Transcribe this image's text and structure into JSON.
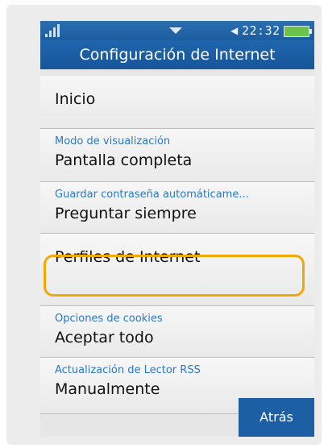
{
  "status_bar": {
    "time": "22:32",
    "icons": [
      "signal-icon",
      "dropdown-arrow-icon",
      "speaker-icon",
      "battery-icon"
    ]
  },
  "header": {
    "title": "Configuración de Internet"
  },
  "settings": [
    {
      "id": "inicio",
      "subtitle": "",
      "value": "Inicio"
    },
    {
      "id": "modo",
      "subtitle": "Modo de visualización",
      "value": "Pantalla completa"
    },
    {
      "id": "guardar",
      "subtitle": "Guardar contraseña automáticame...",
      "value": "Preguntar siempre"
    },
    {
      "id": "perfiles",
      "subtitle": "",
      "value": "Perfiles de Internet"
    },
    {
      "id": "cookies",
      "subtitle": "Opciones de cookies",
      "value": "Aceptar todo"
    },
    {
      "id": "rss",
      "subtitle": "Actualización de Lector RSS",
      "value": "Manualmente"
    }
  ],
  "softkeys": {
    "back_label": "Atrás"
  },
  "colors": {
    "title_bar": "#1f66ad",
    "subtitle_text": "#2a78c8",
    "highlight_border": "#f2a800",
    "back_button": "#1c5fa5"
  }
}
